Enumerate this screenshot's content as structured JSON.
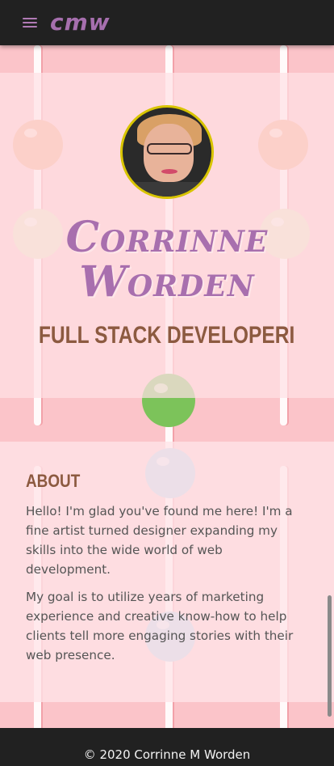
{
  "nav": {
    "menu_icon": "hamburger-menu-icon",
    "brand": "cmw"
  },
  "hero": {
    "avatar_alt": "profile-photo",
    "name": "Corrinne Worden",
    "title": "FULL STACK DEVELOPERI"
  },
  "about": {
    "heading": "ABOUT",
    "paragraph_1": "Hello! I'm glad you've found me here! I'm a fine artist turned designer expanding my skills into the wide world of web development.",
    "paragraph_2": "My goal is to utilize years of marketing experience and creative know-how to help clients tell more engaging stories with their web presence."
  },
  "footer": {
    "copyright": "© 2020 Corrinne M Worden"
  },
  "colors": {
    "navbar_bg": "#212121",
    "brand_accent": "#a66fae",
    "heading_brown": "#8c5a40",
    "page_pink": "#fcc6cc"
  }
}
